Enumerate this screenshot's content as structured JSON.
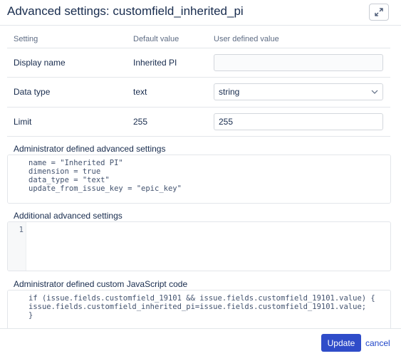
{
  "dialog": {
    "title": "Advanced settings: customfield_inherited_pi",
    "expand_icon": "expand-icon"
  },
  "table": {
    "headers": [
      "Setting",
      "Default value",
      "User defined value"
    ],
    "rows": [
      {
        "setting": "Display name",
        "default": "Inherited PI",
        "user_value": ""
      },
      {
        "setting": "Data type",
        "default": "text",
        "user_value": "string"
      },
      {
        "setting": "Limit",
        "default": "255",
        "user_value": "255"
      }
    ]
  },
  "admin_settings": {
    "label": "Administrator defined advanced settings",
    "code": "name = \"Inherited PI\"\ndimension = true\ndata_type = \"text\"\nupdate_from_issue_key = \"epic_key\""
  },
  "additional_settings": {
    "label": "Additional advanced settings",
    "line_number": "1",
    "code": ""
  },
  "admin_js": {
    "label": "Administrator defined custom JavaScript code",
    "code": "if (issue.fields.customfield_19101 && issue.fields.customfield_19101.value) {\nissue.fields.customfield_inherited_pi=issue.fields.customfield_19101.value;\n}"
  },
  "footer": {
    "update_label": "Update",
    "cancel_label": "cancel"
  },
  "colors": {
    "primary": "#2f4cc9",
    "link": "#1f45c8",
    "border": "#e3e6ea"
  }
}
